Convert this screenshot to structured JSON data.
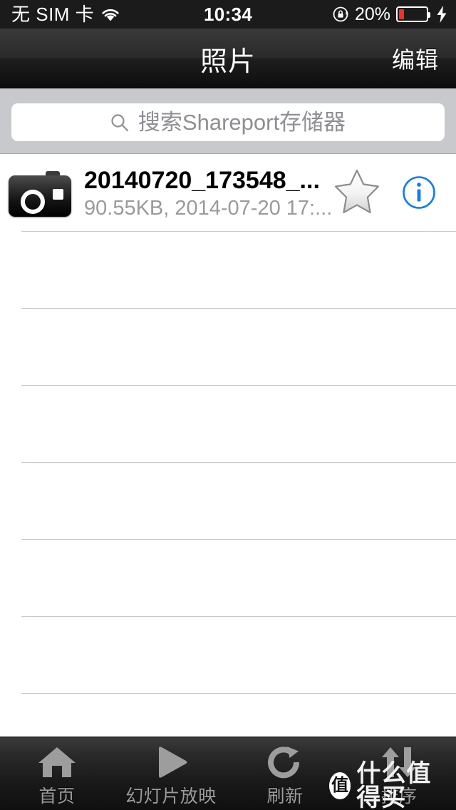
{
  "status_bar": {
    "carrier": "无 SIM 卡",
    "wifi_icon": "wifi-icon",
    "time": "10:34",
    "rotation_lock_icon": "rotation-lock-icon",
    "battery_percent": "20%",
    "battery_level": 20,
    "battery_color": "#fb2d25",
    "charging_icon": "lightning-bolt-icon"
  },
  "nav_bar": {
    "title": "照片",
    "edit_label": "编辑"
  },
  "search": {
    "placeholder": "搜索Shareport存储器",
    "value": "",
    "icon": "search-icon"
  },
  "list": {
    "rows": [
      {
        "icon": "camera-icon",
        "title": "20140720_173548_...",
        "subtitle": "90.55KB, 2014-07-20 17:...",
        "favorite_icon": "star-icon",
        "info_icon": "info-circle-icon",
        "info_color": "#0a7cff"
      }
    ],
    "empty_row_count": 7
  },
  "toolbar": {
    "items": [
      {
        "icon": "home-icon",
        "label": "首页"
      },
      {
        "icon": "play-icon",
        "label": "幻灯片放映"
      },
      {
        "icon": "refresh-icon",
        "label": "刷新"
      },
      {
        "icon": "sort-arrows-icon",
        "label": "排序"
      }
    ]
  },
  "watermark": {
    "badge": "值",
    "text": "什么值得买"
  }
}
